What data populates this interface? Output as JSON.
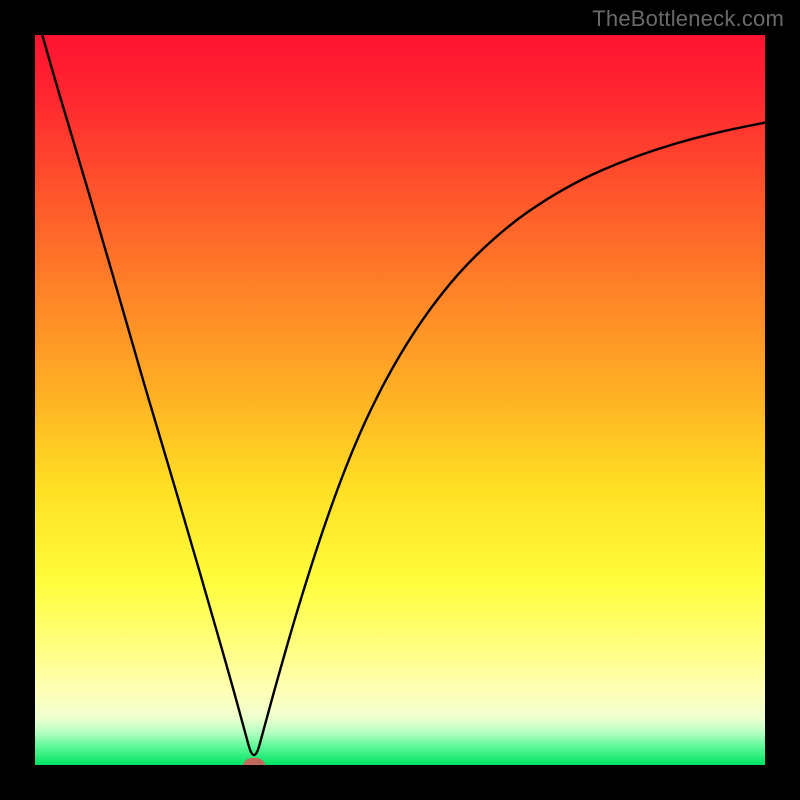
{
  "watermark": "TheBottleneck.com",
  "colors": {
    "frame": "#000000",
    "curve": "#000000",
    "marker": "#c06a5b",
    "watermark_text": "#6a6a6a"
  },
  "chart_data": {
    "type": "line",
    "title": "",
    "xlabel": "",
    "ylabel": "",
    "xlim": [
      0,
      1
    ],
    "ylim": [
      0,
      1
    ],
    "legend": false,
    "gradient_stops": [
      {
        "pos": 0.0,
        "color": "#ff1331"
      },
      {
        "pos": 0.08,
        "color": "#ff2530"
      },
      {
        "pos": 0.2,
        "color": "#ff4f2c"
      },
      {
        "pos": 0.35,
        "color": "#ff8228"
      },
      {
        "pos": 0.5,
        "color": "#ffb324"
      },
      {
        "pos": 0.62,
        "color": "#ffdf24"
      },
      {
        "pos": 0.75,
        "color": "#fffd3c"
      },
      {
        "pos": 0.84,
        "color": "#ffff82"
      },
      {
        "pos": 0.9,
        "color": "#ffffb8"
      },
      {
        "pos": 0.935,
        "color": "#eeffce"
      },
      {
        "pos": 0.955,
        "color": "#b7ffc4"
      },
      {
        "pos": 0.975,
        "color": "#5cf996"
      },
      {
        "pos": 1.0,
        "color": "#02e364"
      }
    ],
    "series": [
      {
        "name": "bottleneck-curve",
        "x": [
          0.01,
          0.03,
          0.06,
          0.09,
          0.12,
          0.15,
          0.18,
          0.21,
          0.24,
          0.27,
          0.285,
          0.3,
          0.315,
          0.33,
          0.36,
          0.4,
          0.44,
          0.48,
          0.52,
          0.56,
          0.6,
          0.65,
          0.7,
          0.75,
          0.8,
          0.85,
          0.9,
          0.95,
          1.0
        ],
        "y": [
          1.0,
          0.93,
          0.83,
          0.728,
          0.625,
          0.52,
          0.42,
          0.318,
          0.215,
          0.11,
          0.055,
          0.0,
          0.055,
          0.11,
          0.215,
          0.34,
          0.445,
          0.528,
          0.595,
          0.65,
          0.695,
          0.74,
          0.775,
          0.803,
          0.825,
          0.843,
          0.858,
          0.87,
          0.88
        ]
      }
    ],
    "marker": {
      "x": 0.3,
      "y": 0.0,
      "rx": 0.015,
      "ry": 0.01
    }
  }
}
